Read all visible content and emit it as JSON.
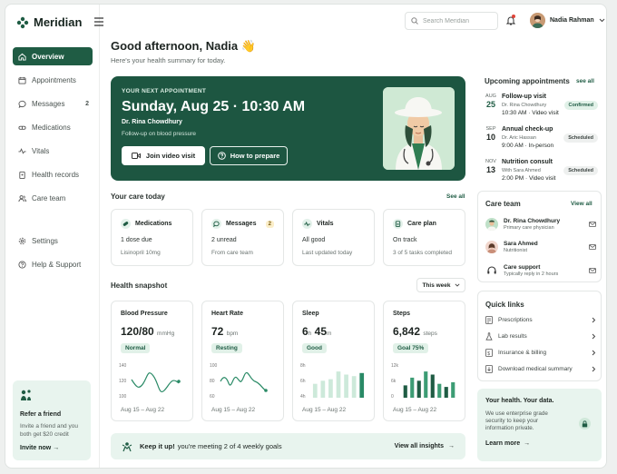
{
  "app": {
    "name": "Meridian"
  },
  "header": {
    "search_placeholder": "Search Meridian",
    "user_name": "Nadia Rahman"
  },
  "nav": {
    "items": [
      {
        "label": "Overview"
      },
      {
        "label": "Appointments"
      },
      {
        "label": "Messages",
        "count": "2"
      },
      {
        "label": "Medications"
      },
      {
        "label": "Vitals"
      },
      {
        "label": "Health records"
      },
      {
        "label": "Care team"
      }
    ],
    "secondary": [
      {
        "label": "Settings"
      },
      {
        "label": "Help & Support"
      }
    ]
  },
  "refer": {
    "title": "Refer a friend",
    "text": "Invite a friend and you both get $20 credit",
    "link": "Invite now"
  },
  "greeting": {
    "title": "Good afternoon, Nadia 👋",
    "subtitle": "Here's your health summary for today."
  },
  "next_appointment": {
    "label": "YOUR NEXT APPOINTMENT",
    "datetime": "Sunday, Aug 25 · 10:30 AM",
    "doctor": "Dr. Rina Chowdhury",
    "reason": "Follow-up on blood pressure",
    "join_label": "Join video visit",
    "prepare_label": "How to prepare"
  },
  "care_today": {
    "title": "Your care today",
    "see_all": "See all",
    "cards": [
      {
        "title": "Medications",
        "status": "1 dose due",
        "detail": "Lisinopril 10mg"
      },
      {
        "title": "Messages",
        "badge": "2",
        "status": "2 unread",
        "detail": "From care team"
      },
      {
        "title": "Vitals",
        "status": "All good",
        "detail": "Last updated today"
      },
      {
        "title": "Care plan",
        "status": "On track",
        "detail": "3 of 5 tasks completed"
      }
    ]
  },
  "snapshot": {
    "title": "Health snapshot",
    "period": "This week",
    "cards": [
      {
        "title": "Blood Pressure",
        "value": "120/80",
        "unit": "mmHg",
        "badge": "Normal",
        "range": "Aug 15 – Aug 22",
        "ticks": [
          "140",
          "120",
          "100"
        ]
      },
      {
        "title": "Heart Rate",
        "value": "72",
        "unit": "bpm",
        "badge": "Resting",
        "range": "Aug 15 – Aug 22",
        "ticks": [
          "100",
          "80",
          "60"
        ]
      },
      {
        "title": "Sleep",
        "value_h": "6",
        "unit_h": "h",
        "value_m": "45",
        "unit_m": "m",
        "badge": "Good",
        "range": "Aug 15 – Aug 22",
        "ticks": [
          "8h",
          "6h",
          "4h"
        ],
        "bars": [
          0.45,
          0.55,
          0.6,
          0.85,
          0.75,
          0.7,
          0.8
        ]
      },
      {
        "title": "Steps",
        "value": "6,842",
        "unit": "steps",
        "badge": "Goal 75%",
        "range": "Aug 15 – Aug 22",
        "ticks": [
          "12k",
          "6k",
          "0"
        ],
        "bars": [
          0.4,
          0.65,
          0.55,
          0.85,
          0.75,
          0.45,
          0.35,
          0.5
        ]
      }
    ]
  },
  "banner": {
    "bold": "Keep it up!",
    "text": "you're meeting 2 of 4 weekly goals",
    "link": "View all insights"
  },
  "upcoming": {
    "title": "Upcoming appointments",
    "see_all": "see all",
    "items": [
      {
        "month": "AUG",
        "day": "25",
        "title": "Follow-up visit",
        "doctor": "Dr. Rina Chowdhury",
        "time": "10:30 AM · Video visit",
        "status": "Confirmed"
      },
      {
        "month": "SEP",
        "day": "10",
        "title": "Annual check-up",
        "doctor": "Dr. Aric Hassan",
        "time": "9:00 AM · In-person",
        "status": "Scheduled"
      },
      {
        "month": "NOV",
        "day": "13",
        "title": "Nutrition consult",
        "doctor": "With Sara Ahmed",
        "time": "2:00 PM · Video visit",
        "status": "Scheduled"
      }
    ]
  },
  "care_team": {
    "title": "Care team",
    "view_all": "View all",
    "members": [
      {
        "name": "Dr. Rina Chowdhury",
        "role": "Primary care physician"
      },
      {
        "name": "Sara Ahmed",
        "role": "Nutritionist"
      },
      {
        "name": "Care support",
        "role": "Typically reply in 2 hours"
      }
    ]
  },
  "quick_links": {
    "title": "Quick links",
    "items": [
      {
        "label": "Prescriptions"
      },
      {
        "label": "Lab results"
      },
      {
        "label": "Insurance & billing"
      },
      {
        "label": "Download medical summary"
      }
    ]
  },
  "promo": {
    "title": "Your health. Your data.",
    "text": "We use enterprise grade security to keep your information private.",
    "link": "Learn more"
  },
  "colors": {
    "brand": "#1f5c44",
    "hero": "#1d5641",
    "accent_light": "#e8f4ee"
  }
}
